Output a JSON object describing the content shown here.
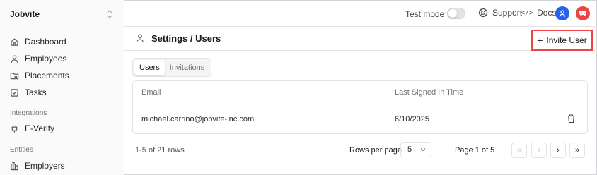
{
  "sidebar": {
    "org_name": "Jobvite",
    "items": [
      {
        "label": "Dashboard",
        "icon": "home-icon"
      },
      {
        "label": "Employees",
        "icon": "person-icon"
      },
      {
        "label": "Placements",
        "icon": "placement-icon"
      },
      {
        "label": "Tasks",
        "icon": "checkbox-icon"
      }
    ],
    "integrations_label": "Integrations",
    "integrations_items": [
      {
        "label": "E-Verify",
        "icon": "plug-icon"
      }
    ],
    "entities_label": "Entities",
    "entities_items": [
      {
        "label": "Employers",
        "icon": "building-icon"
      }
    ]
  },
  "topbar": {
    "test_mode_label": "Test mode",
    "test_mode_on": false,
    "support_label": "Support",
    "docs_label": "Docs",
    "docs_glyph": "</>",
    "user_avatar_color": "#2563eb",
    "mask_avatar_color": "#ef4444"
  },
  "header": {
    "breadcrumb": "Settings / Users",
    "invite_plus": "+",
    "invite_label": "Invite User",
    "highlight_color": "#ef4444"
  },
  "tabs": [
    {
      "label": "Users",
      "active": true
    },
    {
      "label": "Invitations",
      "active": false
    }
  ],
  "table": {
    "columns": [
      "Email",
      "Last Signed In Time"
    ],
    "rows": [
      {
        "email": "michael.carrino@jobvite-inc.com",
        "last_signed_in": "6/10/2025"
      }
    ]
  },
  "pagination": {
    "rows_summary": "1-5 of 21 rows",
    "rows_per_page_label": "Rows per page",
    "rows_per_page_value": "5",
    "page_label": "Page 1 of 5",
    "first_glyph": "«",
    "prev_glyph": "‹",
    "next_glyph": "›",
    "last_glyph": "»"
  }
}
